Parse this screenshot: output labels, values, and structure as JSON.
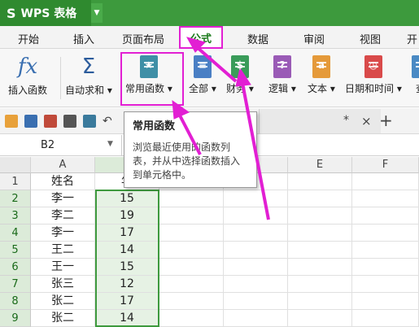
{
  "app": {
    "name": "WPS 表格",
    "logo": "S"
  },
  "tabs": [
    "开始",
    "插入",
    "页面布局",
    "公式",
    "数据",
    "审阅",
    "视图",
    "开"
  ],
  "active_tab": "公式",
  "ribbon": {
    "insert_function": "插入函数",
    "autosum": "自动求和",
    "common_functions": "常用函数",
    "all": "全部",
    "finance": "财务",
    "logic": "逻辑",
    "text": "文本",
    "datetime": "日期和时间",
    "more": "查"
  },
  "file_tab": {
    "marker": "*",
    "close": "×",
    "new": "+"
  },
  "namebox": "B2",
  "columns": [
    "A",
    "B",
    "C",
    "D",
    "E",
    "F"
  ],
  "header_row": {
    "a": "姓名",
    "b": "年"
  },
  "rows": [
    {
      "n": "2",
      "name": "李一",
      "age": "15"
    },
    {
      "n": "3",
      "name": "李二",
      "age": "19"
    },
    {
      "n": "4",
      "name": "李一",
      "age": "17"
    },
    {
      "n": "5",
      "name": "王二",
      "age": "14"
    },
    {
      "n": "6",
      "name": "王一",
      "age": "15"
    },
    {
      "n": "7",
      "name": "张三",
      "age": "12"
    },
    {
      "n": "8",
      "name": "张二",
      "age": "17"
    },
    {
      "n": "9",
      "name": "张二",
      "age": "14"
    }
  ],
  "tooltip": {
    "title": "常用函数",
    "body": "浏览最近使用的函数列表，并从中选择函数插入到单元格中。"
  },
  "colors": {
    "accent": "#3d9a3d",
    "highlight": "#e21fd3"
  }
}
